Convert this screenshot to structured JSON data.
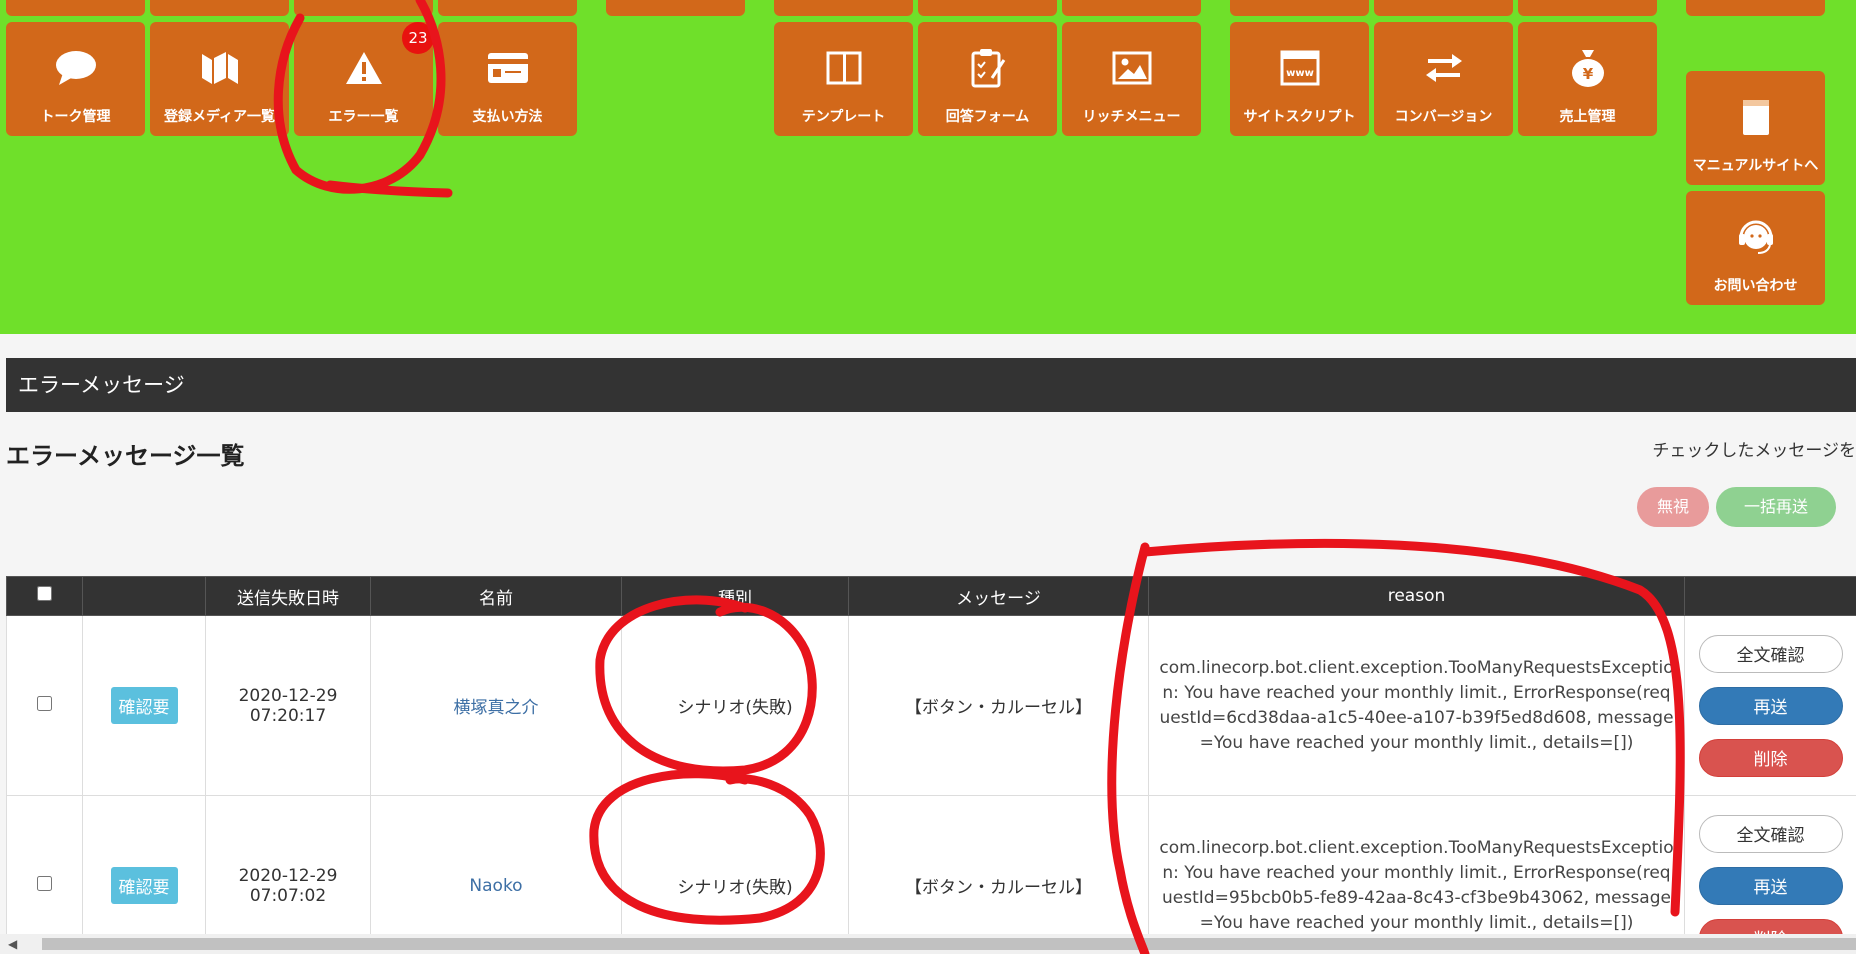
{
  "menu": {
    "tiles": [
      {
        "label": "トーク管理",
        "icon": "speech-bubble-icon"
      },
      {
        "label": "登録メディア一覧",
        "icon": "media-logo-icon"
      },
      {
        "label": "エラー一覧",
        "icon": "warning-icon",
        "badge": "23"
      },
      {
        "label": "支払い方法",
        "icon": "credit-card-icon"
      },
      {
        "label": "テンプレート",
        "icon": "template-columns-icon"
      },
      {
        "label": "回答フォーム",
        "icon": "clipboard-form-icon"
      },
      {
        "label": "リッチメニュー",
        "icon": "image-icon"
      },
      {
        "label": "サイトスクリプト",
        "icon": "browser-www-icon"
      },
      {
        "label": "コンバージョン",
        "icon": "exchange-arrows-icon"
      },
      {
        "label": "売上管理",
        "icon": "yen-bag-icon"
      },
      {
        "label": "マニュアルサイトへ",
        "icon": "manual-book-icon"
      },
      {
        "label": "お問い合わせ",
        "icon": "headset-icon"
      }
    ]
  },
  "panel": {
    "header": "エラーメッセージ"
  },
  "page": {
    "title": "エラーメッセージ一覧"
  },
  "bulk": {
    "label": "チェックしたメッセージを",
    "ignore": "無視",
    "resend_all": "一括再送"
  },
  "table": {
    "headers": [
      "",
      "",
      "送信失敗日時",
      "名前",
      "種別",
      "メッセージ",
      "reason",
      ""
    ],
    "rows": [
      {
        "status": "確認要",
        "date": "2020-12-29",
        "time": "07:20:17",
        "name": "横塚真之介",
        "type": "シナリオ(失敗)",
        "message": "【ボタン・カルーセル】",
        "reason": "com.linecorp.bot.client.exception.TooManyRequestsException: You have reached your monthly limit., ErrorResponse(requestId=6cd38daa-a1c5-40ee-a107-b39f5ed8d608, message=You have reached your monthly limit., details=[])",
        "actions": {
          "view": "全文確認",
          "resend": "再送",
          "delete": "削除"
        }
      },
      {
        "status": "確認要",
        "date": "2020-12-29",
        "time": "07:07:02",
        "name": "Naoko",
        "type": "シナリオ(失敗)",
        "message": "【ボタン・カルーセル】",
        "reason": "com.linecorp.bot.client.exception.TooManyRequestsException: You have reached your monthly limit., ErrorResponse(requestId=95bcb0b5-fe89-42aa-8c43-cf3be9b43062, message=You have reached your monthly limit., details=[])",
        "actions": {
          "view": "全文確認",
          "resend": "再送",
          "delete": "削除"
        }
      }
    ]
  },
  "colors": {
    "menu_bg": "#6fe02a",
    "tile": "#d2681a",
    "annotation": "#e8141c",
    "badge": "#e8120f"
  }
}
